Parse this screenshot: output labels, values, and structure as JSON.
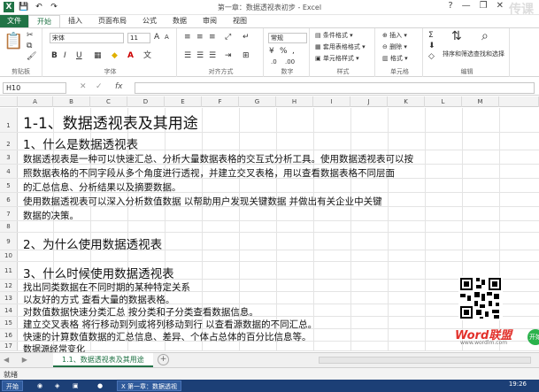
{
  "window": {
    "title": "第一章：数据透视表初步 - Excel",
    "controls": [
      "?",
      "—",
      "❐",
      "✕"
    ]
  },
  "watermark": "传课",
  "ribbon_tabs": [
    "文件",
    "开始",
    "插入",
    "页面布局",
    "公式",
    "数据",
    "审阅",
    "视图"
  ],
  "ribbon": {
    "clipboard": {
      "label": "剪贴板"
    },
    "font": {
      "label": "字体",
      "name": "宋体",
      "size": "11",
      "bold": "B",
      "italic": "I",
      "underline": "U"
    },
    "alignment": {
      "label": "对齐方式"
    },
    "number": {
      "label": "数字",
      "format": "常规",
      "percent": "%",
      "comma": ","
    },
    "styles": {
      "label": "样式",
      "conditional": "条件格式",
      "table_format": "套用表格格式",
      "cell_style": "单元格样式"
    },
    "cells": {
      "label": "单元格",
      "insert": "插入",
      "delete": "删除",
      "format": "格式"
    },
    "editing": {
      "label": "编辑",
      "sort_filter": "排序和筛选",
      "find_select": "查找和选择",
      "sigma": "Σ"
    }
  },
  "formula_bar": {
    "name_box": "H10",
    "fx": "fx",
    "cancel": "✕",
    "confirm": "✓"
  },
  "columns": [
    "A",
    "B",
    "C",
    "D",
    "E",
    "F",
    "G",
    "H",
    "I",
    "J",
    "K",
    "L",
    "M"
  ],
  "rows": [
    {
      "n": "1",
      "text": "1-1、数据透视表及其用途"
    },
    {
      "n": "2",
      "text": "1、什么是数据透视表"
    },
    {
      "n": "3",
      "text": "数据透视表是一种可以快速汇总、分析大量数据表格的交互式分析工具。使用数据透视表可以按"
    },
    {
      "n": "4",
      "text": "照数据表格的不同字段从多个角度进行透视，并建立交叉表格，用以查看数据表格不同层面"
    },
    {
      "n": "5",
      "text": "的汇总信息、分析结果以及摘要数据。"
    },
    {
      "n": "6",
      "text": "使用数据透视表可以深入分析数值数据   以帮助用户发现关键数据   并做出有关企业中关键"
    },
    {
      "n": "7",
      "text": "数据的决策。"
    },
    {
      "n": "8",
      "text": ""
    },
    {
      "n": "9",
      "text": "2、为什么使用数据透视表"
    },
    {
      "n": "10",
      "text": ""
    },
    {
      "n": "11",
      "text": "3、什么时候使用数据透视表"
    },
    {
      "n": "12",
      "text": "找出同类数据在不同时期的某种特定关系"
    },
    {
      "n": "13",
      "text": "以友好的方式   查看大量的数据表格。"
    },
    {
      "n": "14",
      "text": "对数值数据快速分类汇总   按分类和子分类查看数据信息。"
    },
    {
      "n": "15",
      "text": "建立交叉表格    将行移动到列或将列移动到行       以查看源数据的不同汇总。"
    },
    {
      "n": "16",
      "text": "快速的计算数值数据的汇总信息、差异、个体占总体的百分比信息等。"
    },
    {
      "n": "17",
      "text": "数据源经常变化"
    }
  ],
  "logo": {
    "brand": "Word联盟",
    "site": "www.wordlm.com"
  },
  "badge": "开始",
  "sheet": {
    "nav": "◀ ▶",
    "tab": "1.1、数据透视表及其用途",
    "add": "+"
  },
  "status": {
    "ready": "就绪"
  },
  "taskbar": {
    "start": "开始",
    "excel_item": "第一章：数据透视",
    "clock": "19:26"
  }
}
